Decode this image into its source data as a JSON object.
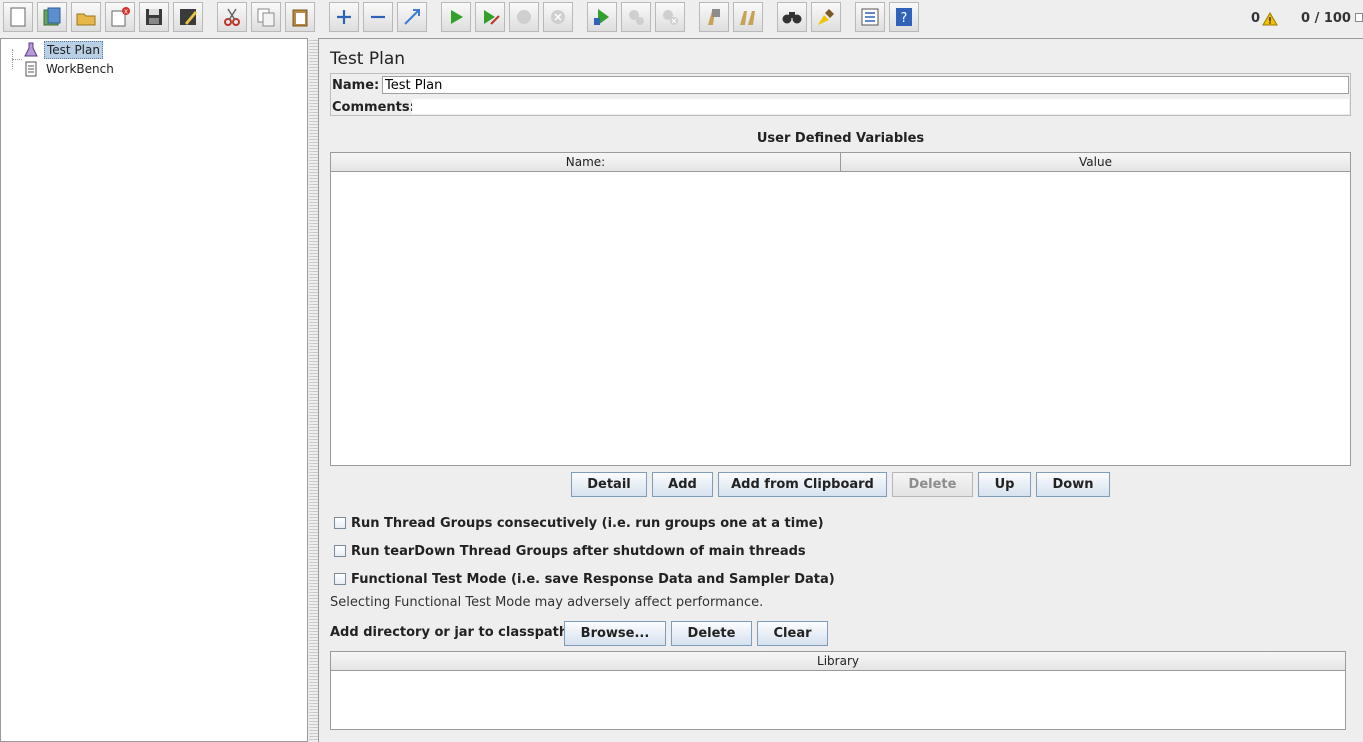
{
  "toolbar": {
    "icons": [
      "new-file-icon",
      "templates-icon",
      "open-icon",
      "close-icon",
      "save-icon",
      "save-as-icon",
      "cut-icon",
      "copy-icon",
      "paste-icon",
      "expand-icon",
      "collapse-icon",
      "toggle-icon",
      "start-icon",
      "start-no-pause-icon",
      "stop-icon",
      "shutdown-icon",
      "remote-start-icon",
      "remote-stop-icon",
      "remote-shutdown-icon",
      "clear-icon",
      "clear-all-icon",
      "search-icon",
      "reset-search-icon",
      "function-helper-icon",
      "help-icon"
    ],
    "error_count": "0",
    "threads": "0 / 100"
  },
  "tree": {
    "items": [
      {
        "label": "Test Plan",
        "icon": "test-plan-icon",
        "selected": true
      },
      {
        "label": "WorkBench",
        "icon": "workbench-icon",
        "selected": false
      }
    ]
  },
  "main": {
    "title": "Test Plan",
    "name_label": "Name:",
    "name_value": "Test Plan",
    "comments_label": "Comments:",
    "udv_title": "User Defined Variables",
    "udv_columns": [
      "Name:",
      "Value"
    ],
    "udv_buttons": [
      "Detail",
      "Add",
      "Add from Clipboard",
      "Delete",
      "Up",
      "Down"
    ],
    "checkboxes": [
      "Run Thread Groups consecutively (i.e. run groups one at a time)",
      "Run tearDown Thread Groups after shutdown of main threads",
      "Functional Test Mode (i.e. save Response Data and Sampler Data)"
    ],
    "functional_note": "Selecting Functional Test Mode may adversely affect performance.",
    "classpath_label": "Add directory or jar to classpath",
    "classpath_buttons": [
      "Browse...",
      "Delete",
      "Clear"
    ],
    "library_column": "Library"
  },
  "colors": {
    "selection": "#b8cfe5",
    "button_border": "#7f9db9",
    "warning": "#f2c200"
  }
}
